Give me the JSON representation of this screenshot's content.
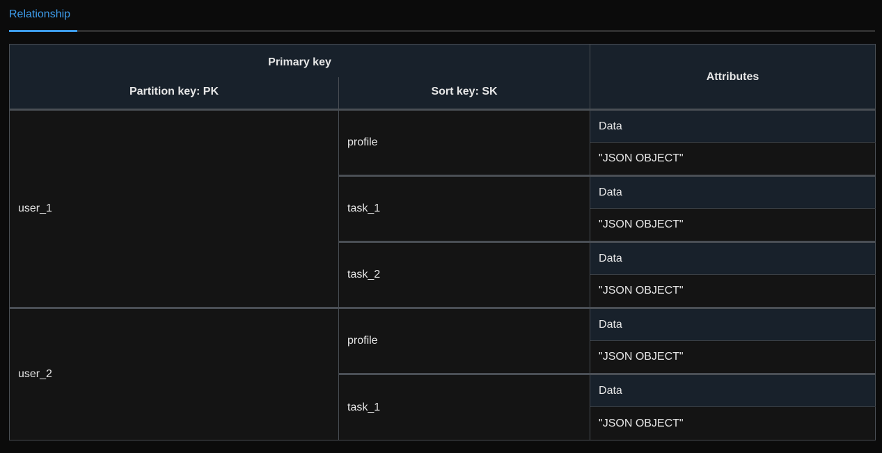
{
  "tabs": [
    {
      "label": "Relationship",
      "active": true
    }
  ],
  "table": {
    "header": {
      "primary_key": "Primary key",
      "partition_key": "Partition key: PK",
      "sort_key": "Sort key: SK",
      "attributes": "Attributes"
    },
    "groups": [
      {
        "pk": "user_1",
        "items": [
          {
            "sk": "profile",
            "attr_name": "Data",
            "attr_value": "\"JSON OBJECT\""
          },
          {
            "sk": "task_1",
            "attr_name": "Data",
            "attr_value": "\"JSON OBJECT\""
          },
          {
            "sk": "task_2",
            "attr_name": "Data",
            "attr_value": "\"JSON OBJECT\""
          }
        ]
      },
      {
        "pk": "user_2",
        "items": [
          {
            "sk": "profile",
            "attr_name": "Data",
            "attr_value": "\"JSON OBJECT\""
          },
          {
            "sk": "task_1",
            "attr_name": "Data",
            "attr_value": "\"JSON OBJECT\""
          }
        ]
      }
    ]
  },
  "colors": {
    "accent": "#3d9be9",
    "background": "#0b0b0b",
    "header_bg": "#18212b",
    "cell_bg": "#141414"
  }
}
